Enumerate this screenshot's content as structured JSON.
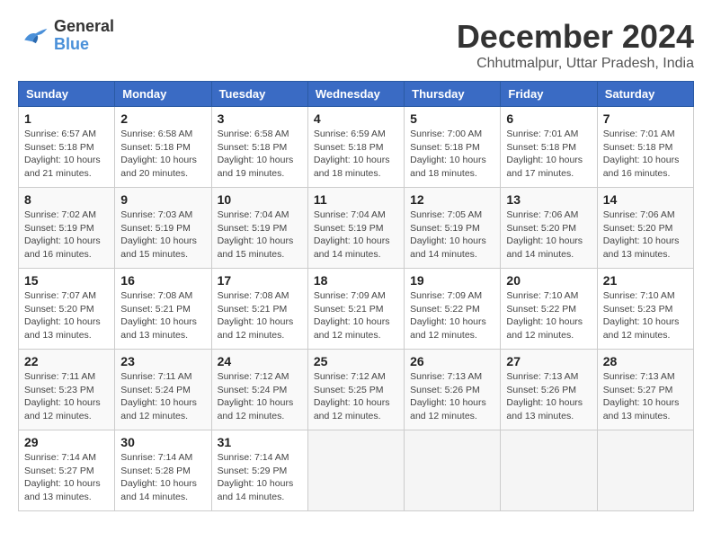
{
  "logo": {
    "line1": "General",
    "line2": "Blue"
  },
  "title": "December 2024",
  "location": "Chhutmalpur, Uttar Pradesh, India",
  "weekdays": [
    "Sunday",
    "Monday",
    "Tuesday",
    "Wednesday",
    "Thursday",
    "Friday",
    "Saturday"
  ],
  "weeks": [
    [
      {
        "day": "1",
        "info": "Sunrise: 6:57 AM\nSunset: 5:18 PM\nDaylight: 10 hours\nand 21 minutes."
      },
      {
        "day": "2",
        "info": "Sunrise: 6:58 AM\nSunset: 5:18 PM\nDaylight: 10 hours\nand 20 minutes."
      },
      {
        "day": "3",
        "info": "Sunrise: 6:58 AM\nSunset: 5:18 PM\nDaylight: 10 hours\nand 19 minutes."
      },
      {
        "day": "4",
        "info": "Sunrise: 6:59 AM\nSunset: 5:18 PM\nDaylight: 10 hours\nand 18 minutes."
      },
      {
        "day": "5",
        "info": "Sunrise: 7:00 AM\nSunset: 5:18 PM\nDaylight: 10 hours\nand 18 minutes."
      },
      {
        "day": "6",
        "info": "Sunrise: 7:01 AM\nSunset: 5:18 PM\nDaylight: 10 hours\nand 17 minutes."
      },
      {
        "day": "7",
        "info": "Sunrise: 7:01 AM\nSunset: 5:18 PM\nDaylight: 10 hours\nand 16 minutes."
      }
    ],
    [
      {
        "day": "8",
        "info": "Sunrise: 7:02 AM\nSunset: 5:19 PM\nDaylight: 10 hours\nand 16 minutes."
      },
      {
        "day": "9",
        "info": "Sunrise: 7:03 AM\nSunset: 5:19 PM\nDaylight: 10 hours\nand 15 minutes."
      },
      {
        "day": "10",
        "info": "Sunrise: 7:04 AM\nSunset: 5:19 PM\nDaylight: 10 hours\nand 15 minutes."
      },
      {
        "day": "11",
        "info": "Sunrise: 7:04 AM\nSunset: 5:19 PM\nDaylight: 10 hours\nand 14 minutes."
      },
      {
        "day": "12",
        "info": "Sunrise: 7:05 AM\nSunset: 5:19 PM\nDaylight: 10 hours\nand 14 minutes."
      },
      {
        "day": "13",
        "info": "Sunrise: 7:06 AM\nSunset: 5:20 PM\nDaylight: 10 hours\nand 14 minutes."
      },
      {
        "day": "14",
        "info": "Sunrise: 7:06 AM\nSunset: 5:20 PM\nDaylight: 10 hours\nand 13 minutes."
      }
    ],
    [
      {
        "day": "15",
        "info": "Sunrise: 7:07 AM\nSunset: 5:20 PM\nDaylight: 10 hours\nand 13 minutes."
      },
      {
        "day": "16",
        "info": "Sunrise: 7:08 AM\nSunset: 5:21 PM\nDaylight: 10 hours\nand 13 minutes."
      },
      {
        "day": "17",
        "info": "Sunrise: 7:08 AM\nSunset: 5:21 PM\nDaylight: 10 hours\nand 12 minutes."
      },
      {
        "day": "18",
        "info": "Sunrise: 7:09 AM\nSunset: 5:21 PM\nDaylight: 10 hours\nand 12 minutes."
      },
      {
        "day": "19",
        "info": "Sunrise: 7:09 AM\nSunset: 5:22 PM\nDaylight: 10 hours\nand 12 minutes."
      },
      {
        "day": "20",
        "info": "Sunrise: 7:10 AM\nSunset: 5:22 PM\nDaylight: 10 hours\nand 12 minutes."
      },
      {
        "day": "21",
        "info": "Sunrise: 7:10 AM\nSunset: 5:23 PM\nDaylight: 10 hours\nand 12 minutes."
      }
    ],
    [
      {
        "day": "22",
        "info": "Sunrise: 7:11 AM\nSunset: 5:23 PM\nDaylight: 10 hours\nand 12 minutes."
      },
      {
        "day": "23",
        "info": "Sunrise: 7:11 AM\nSunset: 5:24 PM\nDaylight: 10 hours\nand 12 minutes."
      },
      {
        "day": "24",
        "info": "Sunrise: 7:12 AM\nSunset: 5:24 PM\nDaylight: 10 hours\nand 12 minutes."
      },
      {
        "day": "25",
        "info": "Sunrise: 7:12 AM\nSunset: 5:25 PM\nDaylight: 10 hours\nand 12 minutes."
      },
      {
        "day": "26",
        "info": "Sunrise: 7:13 AM\nSunset: 5:26 PM\nDaylight: 10 hours\nand 12 minutes."
      },
      {
        "day": "27",
        "info": "Sunrise: 7:13 AM\nSunset: 5:26 PM\nDaylight: 10 hours\nand 13 minutes."
      },
      {
        "day": "28",
        "info": "Sunrise: 7:13 AM\nSunset: 5:27 PM\nDaylight: 10 hours\nand 13 minutes."
      }
    ],
    [
      {
        "day": "29",
        "info": "Sunrise: 7:14 AM\nSunset: 5:27 PM\nDaylight: 10 hours\nand 13 minutes."
      },
      {
        "day": "30",
        "info": "Sunrise: 7:14 AM\nSunset: 5:28 PM\nDaylight: 10 hours\nand 14 minutes."
      },
      {
        "day": "31",
        "info": "Sunrise: 7:14 AM\nSunset: 5:29 PM\nDaylight: 10 hours\nand 14 minutes."
      },
      {
        "day": "",
        "info": ""
      },
      {
        "day": "",
        "info": ""
      },
      {
        "day": "",
        "info": ""
      },
      {
        "day": "",
        "info": ""
      }
    ]
  ]
}
